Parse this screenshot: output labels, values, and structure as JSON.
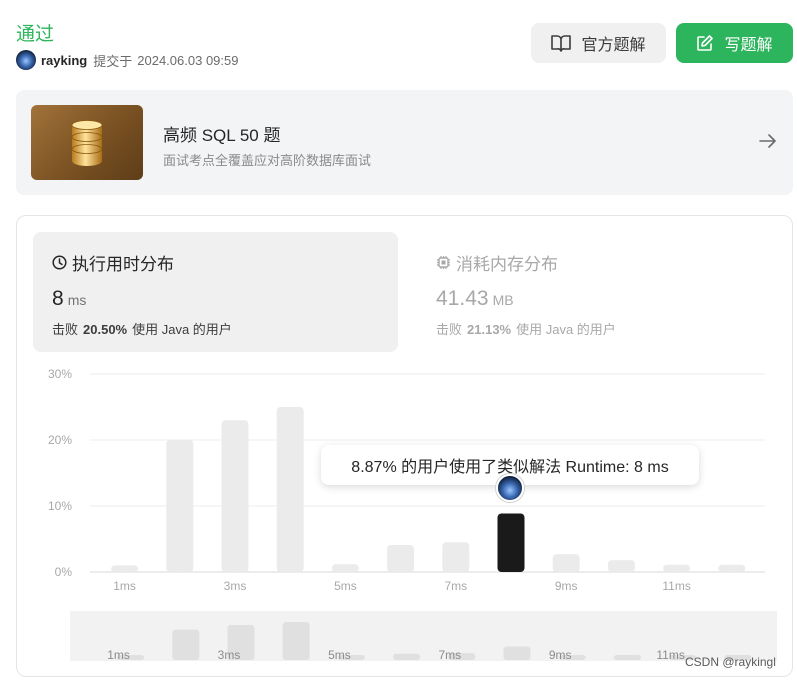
{
  "header": {
    "status": "通过",
    "username": "rayking",
    "submitted_label": "提交于",
    "submitted_at": "2024.06.03 09:59",
    "official_solution_label": "官方题解",
    "write_solution_label": "写题解"
  },
  "plan": {
    "title": "高频 SQL 50 题",
    "subtitle": "面试考点全覆盖应对高阶数据库面试"
  },
  "runtime": {
    "title": "执行用时分布",
    "value": "8",
    "unit": "ms",
    "beats_label": "击败",
    "beats_pct": "20.50%",
    "beats_suffix": "使用 Java 的用户"
  },
  "memory": {
    "title": "消耗内存分布",
    "value": "41.43",
    "unit": "MB",
    "beats_label": "击败",
    "beats_pct": "21.13%",
    "beats_suffix": "使用 Java 的用户"
  },
  "tooltip": "8.87% 的用户使用了类似解法 Runtime: 8 ms",
  "watermark": "CSDN @raykingl",
  "colors": {
    "accent": "#2db55d",
    "bar": "#ebebeb",
    "highlight": "#1a1a1a"
  },
  "chart_data": {
    "type": "bar",
    "x": [
      1,
      2,
      3,
      4,
      5,
      6,
      7,
      8,
      9,
      10,
      11,
      12
    ],
    "values": [
      1.0,
      20.0,
      23.0,
      25.0,
      1.2,
      4.1,
      4.5,
      8.87,
      2.7,
      1.8,
      1.1,
      1.1
    ],
    "highlight_index": 7,
    "y_ticks": [
      "0%",
      "10%",
      "20%",
      "30%"
    ],
    "ylim": [
      0,
      30
    ],
    "x_ticks": [
      "1ms",
      "3ms",
      "5ms",
      "7ms",
      "9ms",
      "11ms"
    ],
    "overview_x_ticks": [
      "1ms",
      "3ms",
      "5ms",
      "7ms",
      "9ms",
      "11ms"
    ],
    "grid": true
  }
}
